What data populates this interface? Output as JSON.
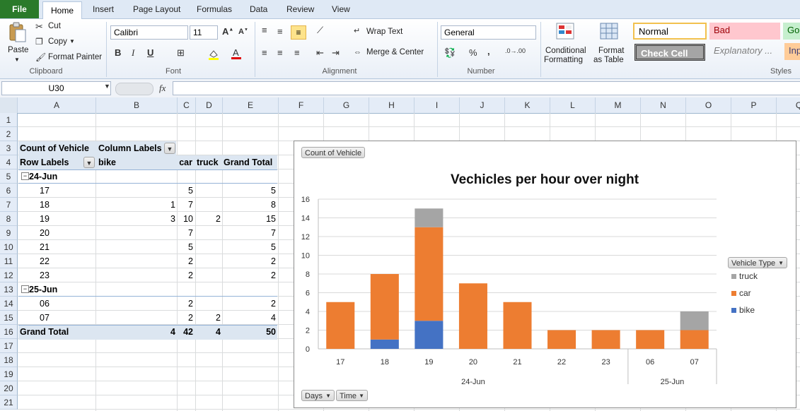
{
  "tabs": {
    "file": "File",
    "home": "Home",
    "insert": "Insert",
    "page_layout": "Page Layout",
    "formulas": "Formulas",
    "data": "Data",
    "review": "Review",
    "view": "View"
  },
  "ribbon": {
    "clipboard": {
      "paste": "Paste",
      "cut": "Cut",
      "copy": "Copy",
      "format_painter": "Format Painter",
      "label": "Clipboard"
    },
    "font": {
      "name": "Calibri",
      "size": "11",
      "bold": "B",
      "italic": "I",
      "underline": "U",
      "label": "Font"
    },
    "alignment": {
      "wrap_text": "Wrap Text",
      "merge_center": "Merge & Center",
      "label": "Alignment"
    },
    "number": {
      "format": "General",
      "label": "Number"
    },
    "styles": {
      "conditional_formatting_1": "Conditional",
      "conditional_formatting_2": "Formatting",
      "format_as_table_1": "Format",
      "format_as_table_2": "as Table",
      "normal": "Normal",
      "bad": "Bad",
      "good": "Go",
      "check_cell": "Check Cell",
      "explanatory": "Explanatory ...",
      "input": "Inp",
      "label": "Styles"
    }
  },
  "formula_bar": {
    "name_box": "U30",
    "fx": "fx",
    "content": ""
  },
  "columns": [
    "A",
    "B",
    "C",
    "D",
    "E",
    "F",
    "G",
    "H",
    "I",
    "J",
    "K",
    "L",
    "M",
    "N",
    "O",
    "P",
    "Q"
  ],
  "rows": [
    "1",
    "2",
    "3",
    "4",
    "5",
    "6",
    "7",
    "8",
    "9",
    "10",
    "11",
    "12",
    "13",
    "14",
    "15",
    "16",
    "17",
    "18",
    "19",
    "20",
    "21"
  ],
  "pivot": {
    "r3": {
      "a": "Count of Vehicle",
      "b": "Column Labels"
    },
    "r4": {
      "a": "Row Labels",
      "b": "bike",
      "c": "car",
      "d": "truck",
      "e": "Grand Total"
    },
    "g1": "24-Jun",
    "rows1": [
      {
        "h": "17",
        "bike": "",
        "car": "5",
        "truck": "",
        "total": "5"
      },
      {
        "h": "18",
        "bike": "1",
        "car": "7",
        "truck": "",
        "total": "8"
      },
      {
        "h": "19",
        "bike": "3",
        "car": "10",
        "truck": "2",
        "total": "15"
      },
      {
        "h": "20",
        "bike": "",
        "car": "7",
        "truck": "",
        "total": "7"
      },
      {
        "h": "21",
        "bike": "",
        "car": "5",
        "truck": "",
        "total": "5"
      },
      {
        "h": "22",
        "bike": "",
        "car": "2",
        "truck": "",
        "total": "2"
      },
      {
        "h": "23",
        "bike": "",
        "car": "2",
        "truck": "",
        "total": "2"
      }
    ],
    "g2": "25-Jun",
    "rows2": [
      {
        "h": "06",
        "bike": "",
        "car": "2",
        "truck": "",
        "total": "2"
      },
      {
        "h": "07",
        "bike": "",
        "car": "2",
        "truck": "2",
        "total": "4"
      }
    ],
    "grand": {
      "label": "Grand Total",
      "bike": "4",
      "car": "42",
      "truck": "4",
      "total": "50"
    }
  },
  "chart_buttons": {
    "count": "Count of Vehicle",
    "days": "Days",
    "time": "Time",
    "vehicle_type": "Vehicle Type"
  },
  "chart_data": {
    "type": "bar",
    "stacked": true,
    "title": "Vechicles per hour over night",
    "categories": [
      "17",
      "18",
      "19",
      "20",
      "21",
      "22",
      "23",
      "06",
      "07"
    ],
    "groups": [
      {
        "label": "24-Jun",
        "count": 7
      },
      {
        "label": "25-Jun",
        "count": 2
      }
    ],
    "series": [
      {
        "name": "bike",
        "values": [
          0,
          1,
          3,
          0,
          0,
          0,
          0,
          0,
          0
        ],
        "color": "#4472c4"
      },
      {
        "name": "car",
        "values": [
          5,
          7,
          10,
          7,
          5,
          2,
          2,
          2,
          2
        ],
        "color": "#ed7d31"
      },
      {
        "name": "truck",
        "values": [
          0,
          0,
          2,
          0,
          0,
          0,
          0,
          0,
          2
        ],
        "color": "#a5a5a5"
      }
    ],
    "ylim": [
      0,
      16
    ],
    "yticks": [
      "0",
      "2",
      "4",
      "6",
      "8",
      "10",
      "12",
      "14",
      "16"
    ],
    "grid": true,
    "legend": "right"
  }
}
